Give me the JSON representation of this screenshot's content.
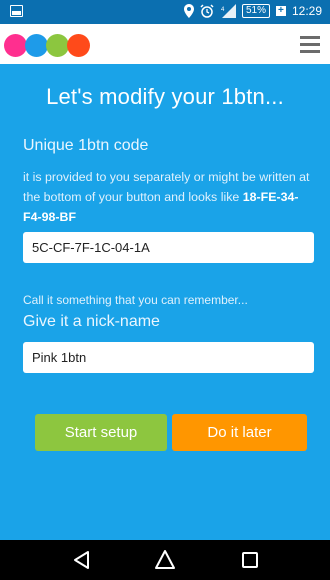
{
  "status_bar": {
    "battery": "51%",
    "time": "12:29",
    "background": "#0b6fb0"
  },
  "header": {
    "logo_colors": [
      "#ff2f8f",
      "#1e9be9",
      "#8cc63f",
      "#ff4a1a"
    ],
    "menu_icon": "hamburger-icon"
  },
  "main": {
    "title": "Let's modify your 1btn...",
    "code_label": "Unique 1btn code",
    "code_help_prefix": "it is provided to you separately or might be written at the bottom of your button and looks like ",
    "code_example": "18-FE-34-F4-98-BF",
    "code_value": "5C-CF-7F-1C-04-1A",
    "nickname_hint": "Call it something that you can remember...",
    "nickname_label": "Give it a nick-name",
    "nickname_value": "Pink 1btn"
  },
  "buttons": {
    "start_label": "Start setup",
    "later_label": "Do it later",
    "start_color": "#8dc63f",
    "later_color": "#ff9600"
  },
  "nav": {
    "icons": [
      "back-icon",
      "home-icon",
      "recents-icon"
    ]
  },
  "colors": {
    "background": "#1aa3e8"
  }
}
